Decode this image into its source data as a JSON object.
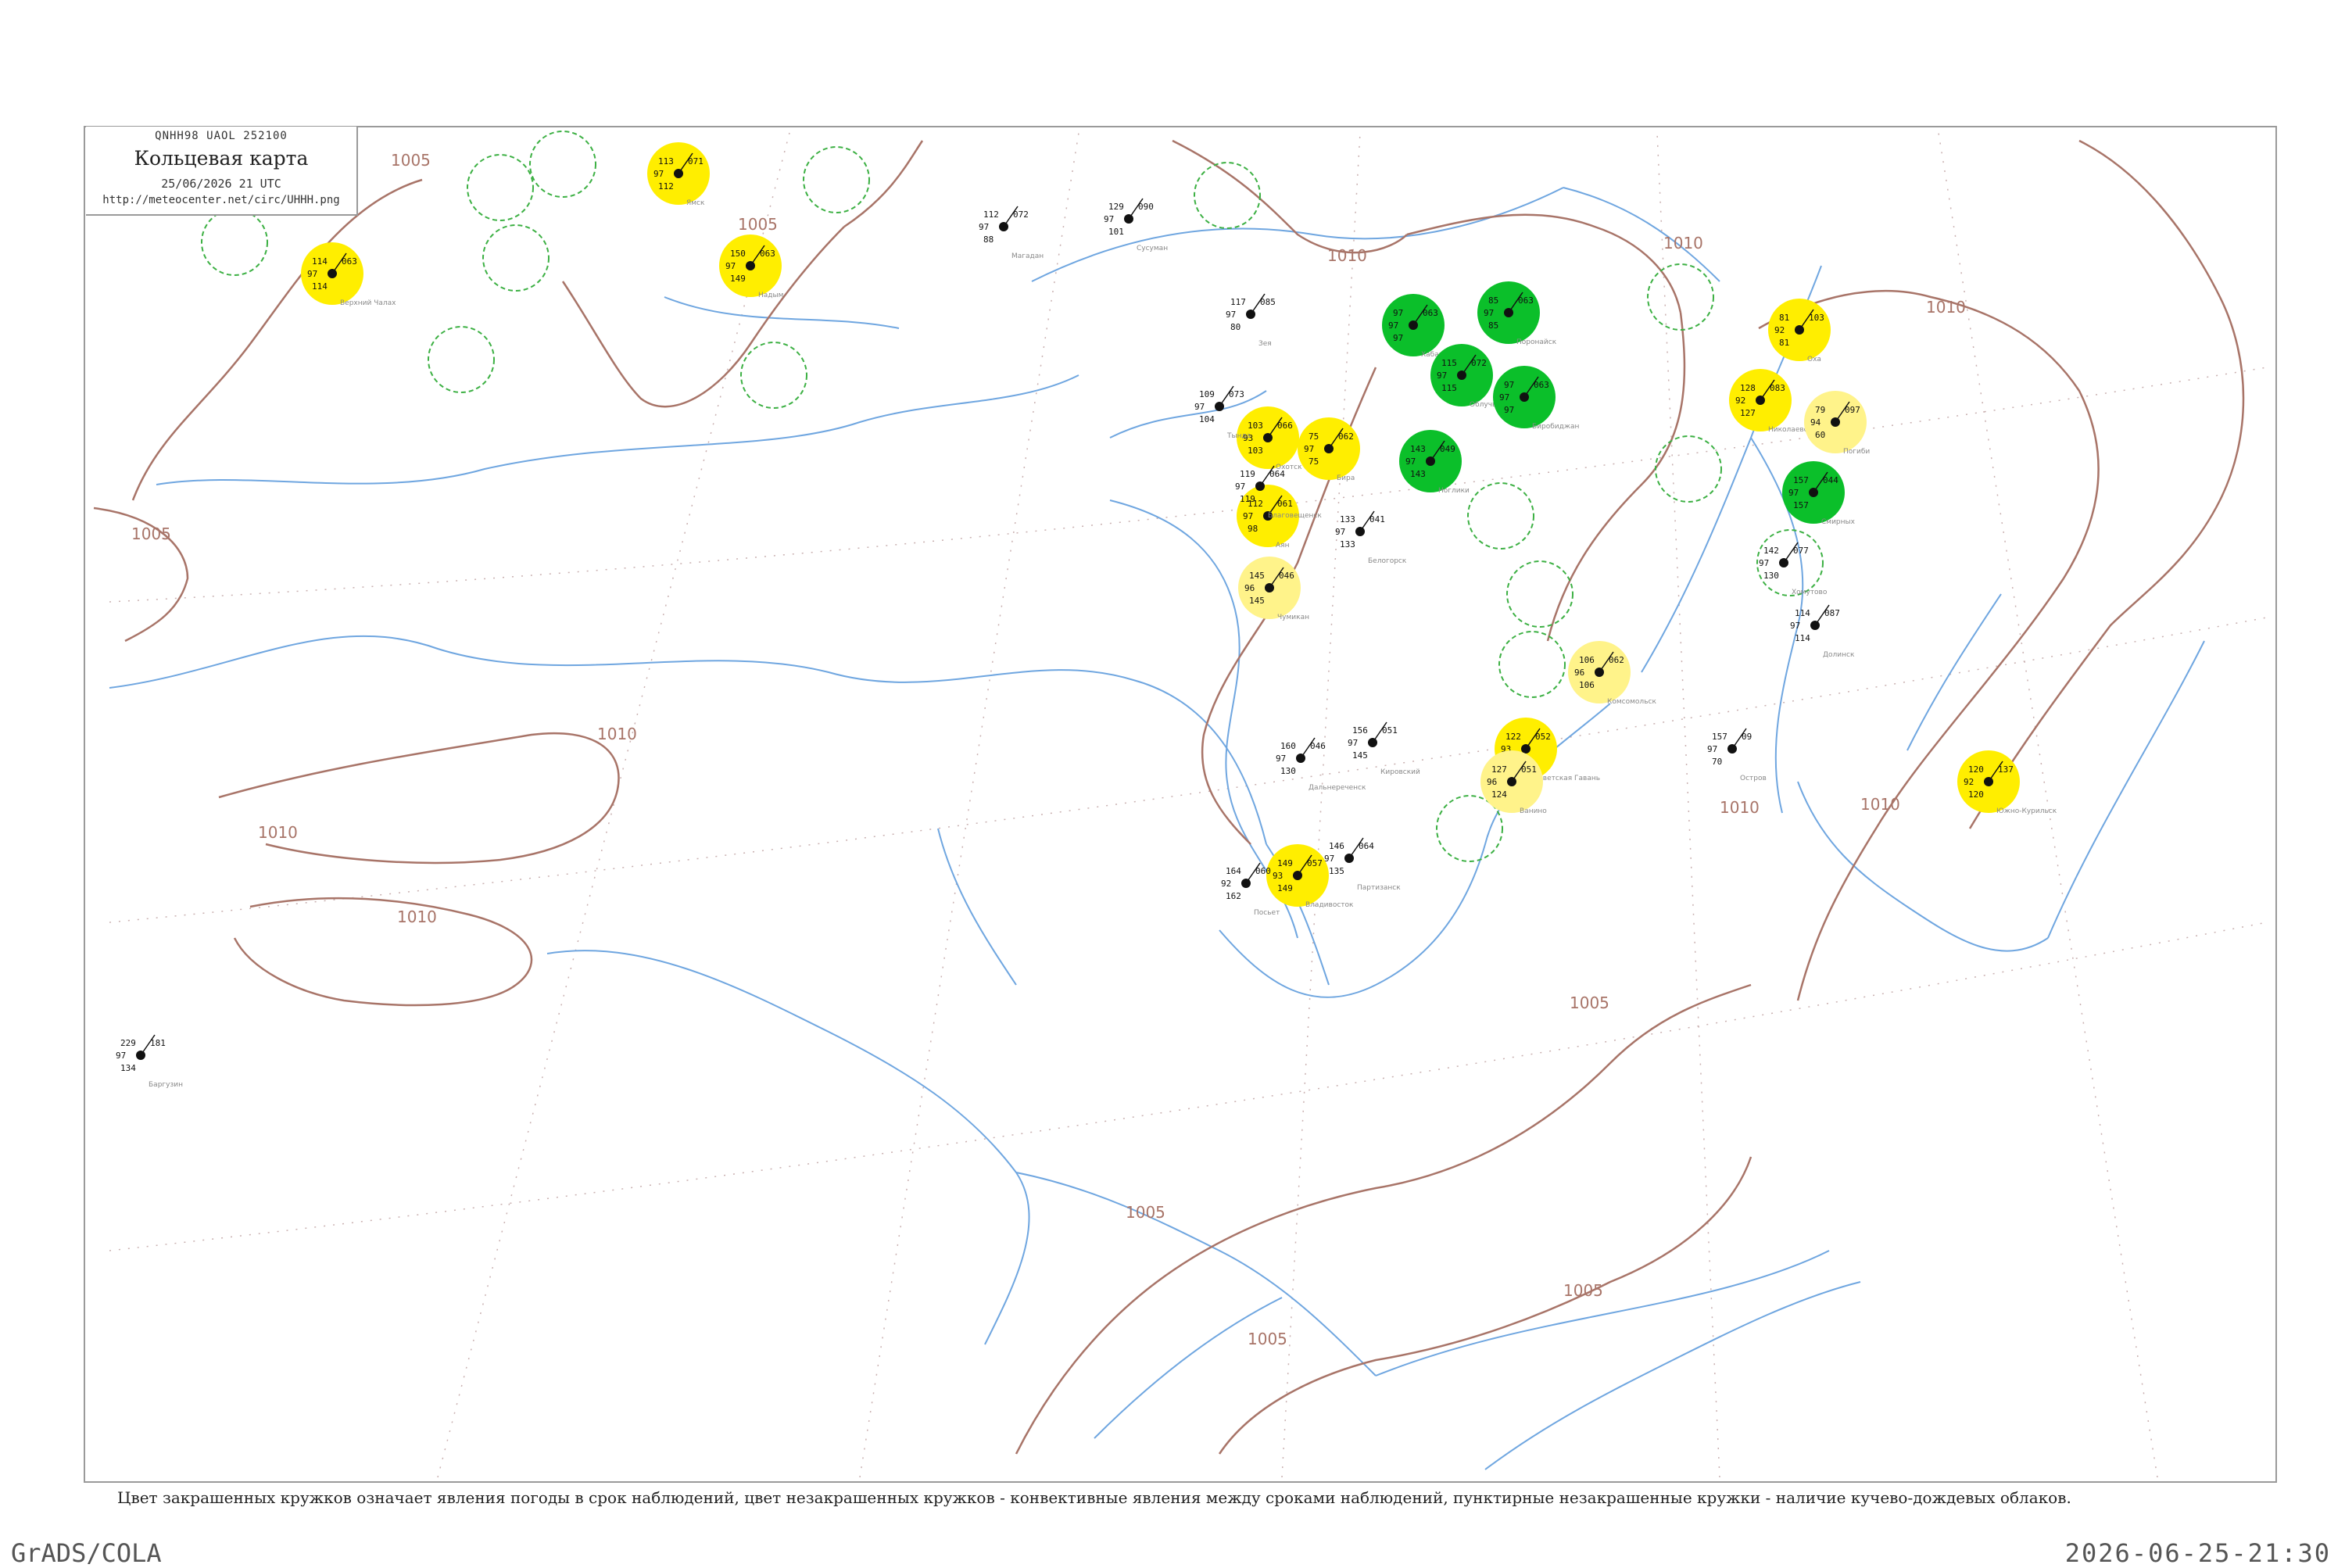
{
  "header": {
    "code": "QNHH98 UAOL 252100",
    "title": "Кольцевая карта",
    "date": "25/06/2026 21 UTC",
    "url": "http://meteocenter.net/circ/UHHH.png"
  },
  "caption": "Цвет закрашенных кружков означает явления погоды в срок наблюдений, цвет незакрашенных кружков - конвективные явления между сроками наблюдений, пунктирные незакрашенные кружки - наличие кучево-дождевых облаков.",
  "footer": {
    "software": "GrADS/COLA",
    "timestamp": "2026-06-25-21:30"
  },
  "isobar_labels": [
    "1005",
    "1010",
    "1005",
    "1010",
    "1010",
    "1010",
    "1010",
    "1005",
    "1005",
    "1005",
    "1010",
    "1005",
    "1010",
    "1005",
    "1010"
  ],
  "colors": {
    "coast": "#6fa6e0",
    "isobar": "#a87468",
    "rain_fill": "#ffee00",
    "drizzle_fill": "#fff38a",
    "storm_fill": "#0bbf2a",
    "cb_ring": "#3cb043"
  },
  "stations": [
    {
      "name": "Верхний Чалах",
      "top": "114",
      "left": "97",
      "bottom": "114",
      "right": "063",
      "fill": "rain"
    },
    {
      "name": "Надым",
      "top": "150",
      "left": "97",
      "bottom": "149",
      "right": "063",
      "fill": "rain"
    },
    {
      "name": "Ямск",
      "top": "113",
      "left": "97",
      "bottom": "112",
      "right": "071",
      "fill": "rain"
    },
    {
      "name": "Охотск",
      "top": "103",
      "left": "93",
      "bottom": "103",
      "right": "066",
      "fill": "rain"
    },
    {
      "name": "Аян",
      "top": "112",
      "left": "97",
      "bottom": "98",
      "right": "061",
      "fill": "rain"
    },
    {
      "name": "Чумикан",
      "top": "145",
      "left": "96",
      "bottom": "145",
      "right": "046",
      "fill": "drizzle"
    },
    {
      "name": "Николаевск",
      "top": "128",
      "left": "92",
      "bottom": "127",
      "right": "083",
      "fill": "rain"
    },
    {
      "name": "Оха",
      "top": "81",
      "left": "92",
      "bottom": "81",
      "right": "103",
      "fill": "rain"
    },
    {
      "name": "Погиби",
      "top": "79",
      "left": "94",
      "bottom": "60",
      "right": "097",
      "fill": "drizzle"
    },
    {
      "name": "Комсомольск",
      "top": "106",
      "left": "96",
      "bottom": "106",
      "right": "062",
      "fill": "drizzle"
    },
    {
      "name": "Советская Гавань",
      "top": "122",
      "left": "93",
      "bottom": "122",
      "right": "052",
      "fill": "rain"
    },
    {
      "name": "Ванино",
      "top": "127",
      "left": "96",
      "bottom": "124",
      "right": "051",
      "fill": "drizzle"
    },
    {
      "name": "Владивосток",
      "top": "149",
      "left": "93",
      "bottom": "149",
      "right": "057",
      "fill": "rain"
    },
    {
      "name": "Южно-Курильск",
      "top": "120",
      "left": "92",
      "bottom": "120",
      "right": "137",
      "fill": "rain"
    },
    {
      "name": "Бира",
      "top": "75",
      "left": "97",
      "bottom": "75",
      "right": "062",
      "fill": "rain"
    },
    {
      "name": "Хабаровск",
      "top": "97",
      "left": "97",
      "bottom": "97",
      "right": "063",
      "fill": "storm"
    },
    {
      "name": "Облучье",
      "top": "115",
      "left": "97",
      "bottom": "115",
      "right": "072",
      "fill": "storm"
    },
    {
      "name": "Биробиджан",
      "top": "97",
      "left": "97",
      "bottom": "97",
      "right": "063",
      "fill": "storm"
    },
    {
      "name": "Поронайск",
      "top": "85",
      "left": "97",
      "bottom": "85",
      "right": "063",
      "fill": "storm"
    },
    {
      "name": "Ноглики",
      "top": "143",
      "left": "97",
      "bottom": "143",
      "right": "049",
      "fill": "storm"
    },
    {
      "name": "Смирных",
      "top": "157",
      "left": "97",
      "bottom": "157",
      "right": "044",
      "fill": "storm"
    }
  ],
  "plain_stations": [
    {
      "name": "Магадан",
      "top": "112",
      "left": "97",
      "bottom": "88",
      "right": "072"
    },
    {
      "name": "Сусуман",
      "top": "129",
      "left": "97",
      "bottom": "101",
      "right": "090"
    },
    {
      "name": "Зея",
      "top": "117",
      "left": "97",
      "bottom": "80",
      "right": "085"
    },
    {
      "name": "Тында",
      "top": "109",
      "left": "97",
      "bottom": "104",
      "right": "073"
    },
    {
      "name": "Благовещенск",
      "top": "119",
      "left": "97",
      "bottom": "119",
      "right": "064"
    },
    {
      "name": "Белогорск",
      "top": "133",
      "left": "97",
      "bottom": "133",
      "right": "041"
    },
    {
      "name": "Дальнереченск",
      "top": "160",
      "left": "97",
      "bottom": "130",
      "right": "046"
    },
    {
      "name": "Кировский",
      "top": "156",
      "left": "97",
      "bottom": "145",
      "right": "051"
    },
    {
      "name": "Партизанск",
      "top": "146",
      "left": "97",
      "bottom": "135",
      "right": "064"
    },
    {
      "name": "Посьет",
      "top": "164",
      "left": "92",
      "bottom": "162",
      "right": "060"
    },
    {
      "name": "Хомутово",
      "top": "142",
      "left": "97",
      "bottom": "130",
      "right": "077"
    },
    {
      "name": "Долинск",
      "top": "114",
      "left": "97",
      "bottom": "114",
      "right": "087"
    },
    {
      "name": "Остров",
      "top": "157",
      "left": "97",
      "bottom": "70",
      "right": "09"
    },
    {
      "name": "Баргузин",
      "top": "229",
      "left": "97",
      "bottom": "134",
      "right": "181"
    }
  ]
}
